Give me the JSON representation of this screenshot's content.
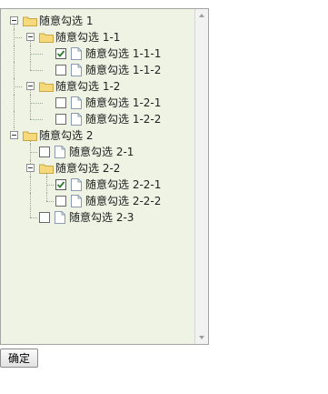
{
  "tree": {
    "nodes": [
      {
        "label": "随意勾选 1",
        "type": "folder",
        "expanded": true
      },
      {
        "label": "随意勾选 1-1",
        "type": "folder",
        "expanded": true
      },
      {
        "label": "随意勾选 1-1-1",
        "type": "leaf",
        "checked": true
      },
      {
        "label": "随意勾选 1-1-2",
        "type": "leaf",
        "checked": false
      },
      {
        "label": "随意勾选 1-2",
        "type": "folder",
        "expanded": true
      },
      {
        "label": "随意勾选 1-2-1",
        "type": "leaf",
        "checked": false
      },
      {
        "label": "随意勾选 1-2-2",
        "type": "leaf",
        "checked": false
      },
      {
        "label": "随意勾选 2",
        "type": "folder",
        "expanded": true
      },
      {
        "label": "随意勾选 2-1",
        "type": "leaf",
        "checked": false
      },
      {
        "label": "随意勾选 2-2",
        "type": "folder",
        "expanded": true
      },
      {
        "label": "随意勾选 2-2-1",
        "type": "leaf",
        "checked": true
      },
      {
        "label": "随意勾选 2-2-2",
        "type": "leaf",
        "checked": false
      },
      {
        "label": "随意勾选 2-3",
        "type": "leaf",
        "checked": false
      }
    ]
  },
  "footer": {
    "confirm_label": "确定"
  },
  "colors": {
    "panel_bg": "#eef3e4",
    "folder": "#f5d97a",
    "checkmark": "#2f7d2f"
  }
}
